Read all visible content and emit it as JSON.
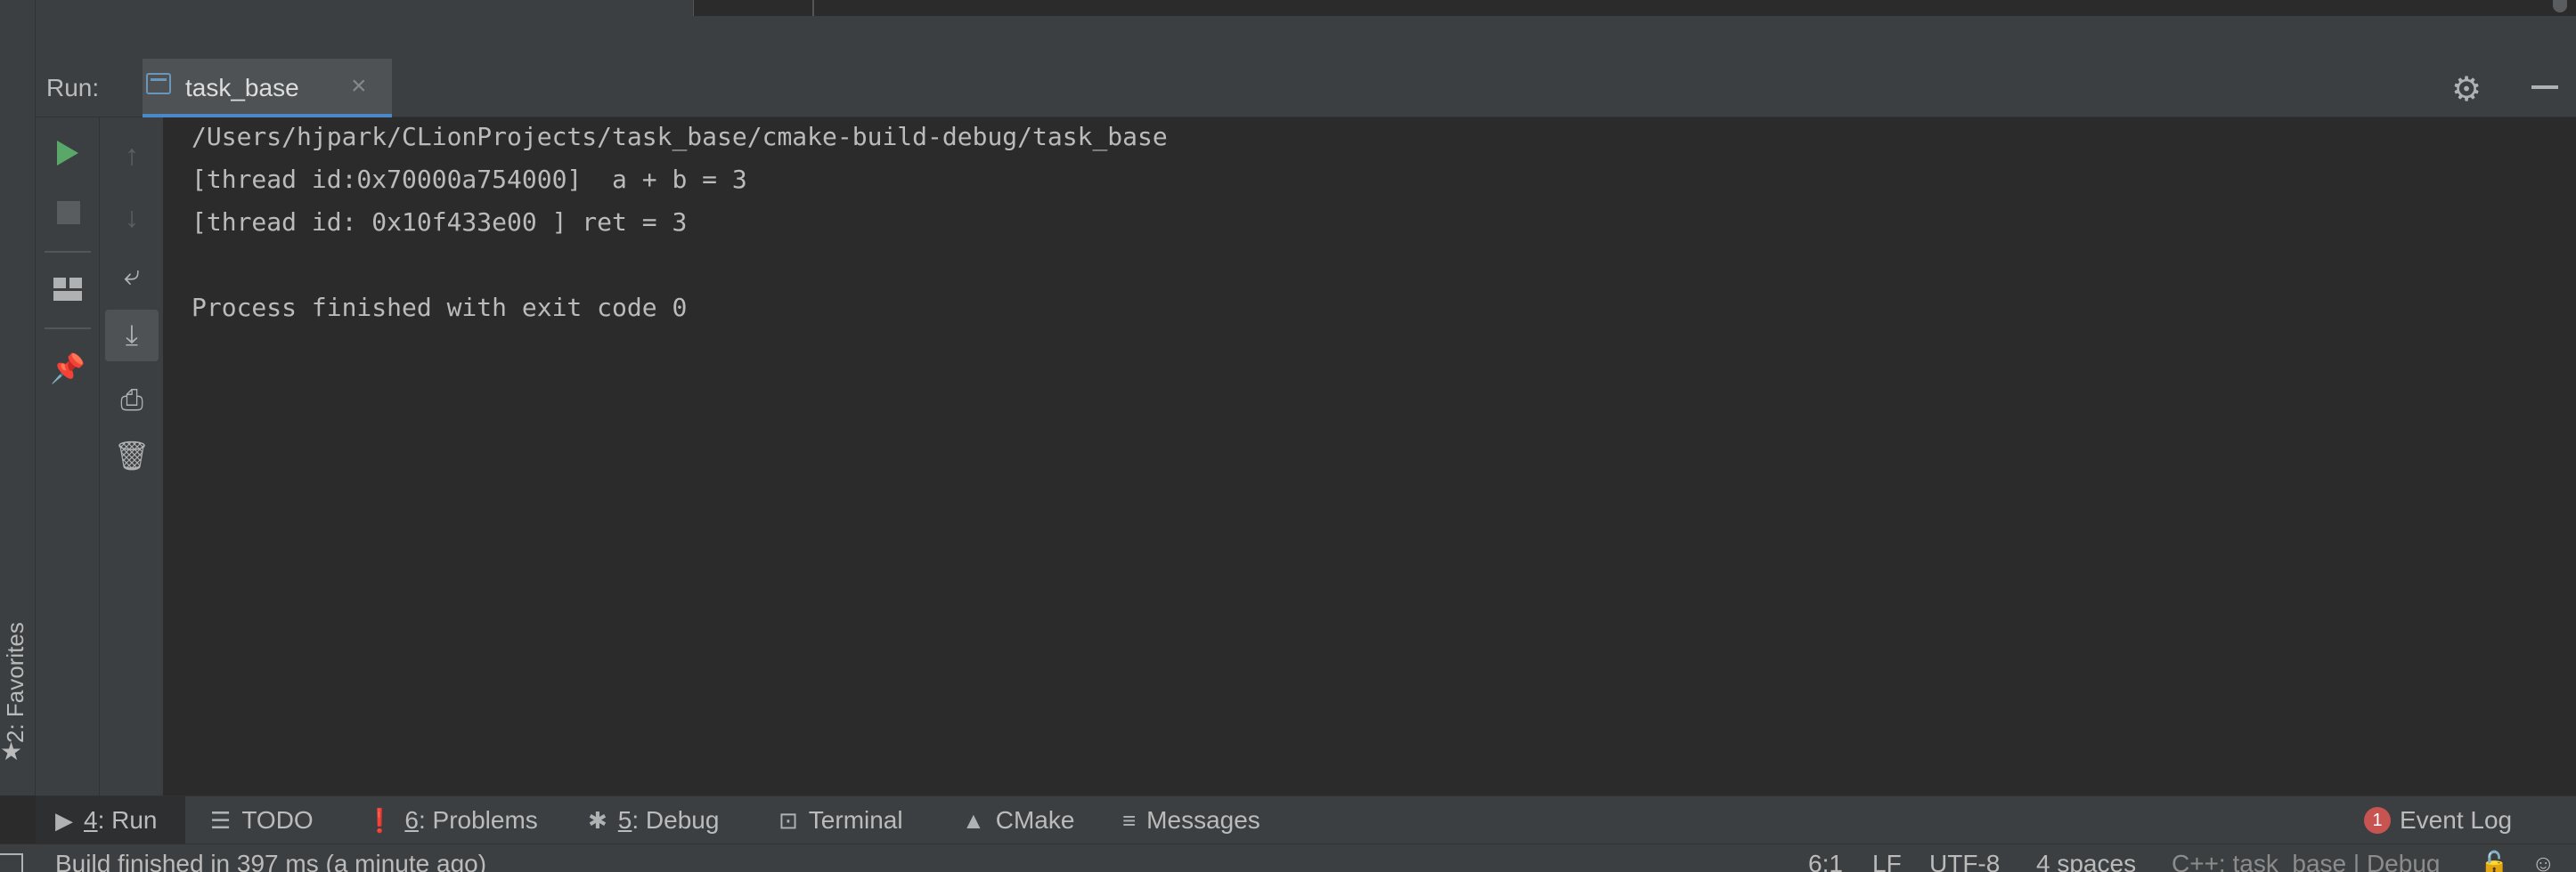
{
  "favorites": {
    "label": "2: Favorites",
    "icon": "star-icon"
  },
  "run_panel": {
    "label": "Run:",
    "tab": {
      "name": "task_base",
      "icon": "console-icon",
      "close_icon": "close-icon"
    },
    "header_icons": [
      "gear-icon",
      "minimize-icon"
    ]
  },
  "left_toolbar": [
    "play-icon",
    "stop-icon",
    "layout-icon",
    "pin-icon"
  ],
  "second_toolbar": [
    "up-arrow-icon",
    "down-arrow-icon",
    "soft-wrap-icon",
    "scroll-to-end-icon",
    "print-icon",
    "trash-icon"
  ],
  "console": {
    "lines": [
      "/Users/hjpark/CLionProjects/task_base/cmake-build-debug/task_base",
      "[thread id:0x70000a754000]  a + b = 3",
      "[thread id: 0x10f433e00 ] ret = 3",
      "",
      "Process finished with exit code 0"
    ]
  },
  "bottom_tabs": {
    "run": {
      "num": "4",
      "label": ": Run",
      "icon": "play-icon"
    },
    "todo": {
      "label": "TODO",
      "icon": "list-icon"
    },
    "problems": {
      "num": "6",
      "label": ": Problems",
      "icon": "warning-icon"
    },
    "debug": {
      "num": "5",
      "label": ": Debug",
      "icon": "bug-icon"
    },
    "terminal": {
      "label": "Terminal",
      "icon": "terminal-icon"
    },
    "cmake": {
      "label": "CMake",
      "icon": "cmake-icon"
    },
    "messages": {
      "label": "Messages",
      "icon": "messages-icon"
    },
    "event_log": {
      "label": "Event Log",
      "badge": "1"
    }
  },
  "status_bar": {
    "message": "Build finished in 397 ms (a minute ago)",
    "position": "6:1",
    "line_separator": "LF",
    "encoding": "UTF-8",
    "indent": "4 spaces",
    "context": "C++: task_base | Debug"
  }
}
